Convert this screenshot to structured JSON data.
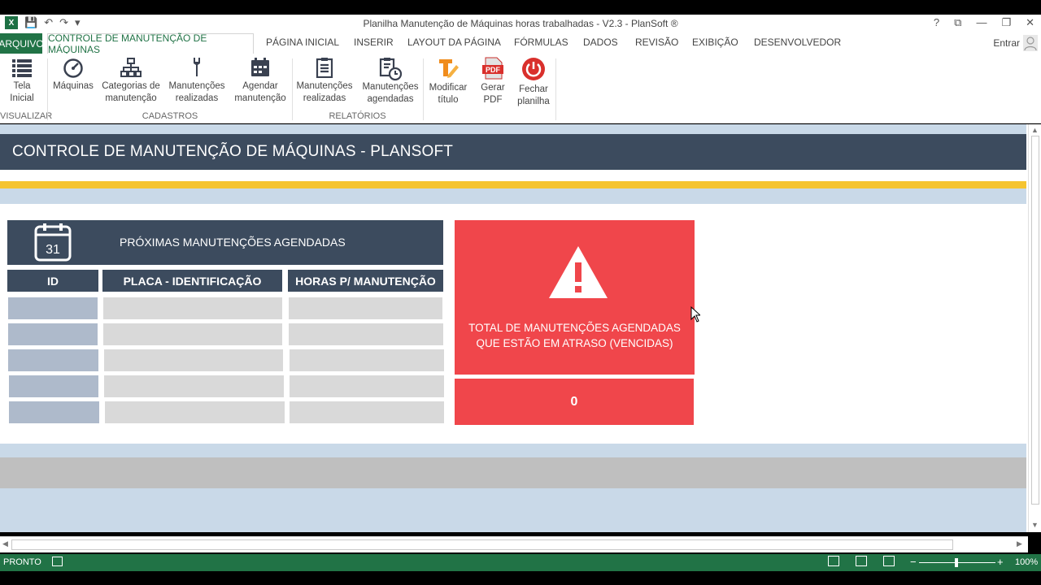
{
  "window": {
    "title": "Planilha Manutenção de Máquinas horas trabalhadas - V2.3 - PlanSoft ®",
    "controls": [
      "?",
      "⧉",
      "—",
      "❐",
      "✕"
    ]
  },
  "ribbon_tabs": {
    "file": "ARQUIVO",
    "active": "CONTROLE DE MANUTENÇÃO DE MÁQUINAS",
    "items": [
      "PÁGINA INICIAL",
      "INSERIR",
      "LAYOUT DA PÁGINA",
      "FÓRMULAS",
      "DADOS",
      "REVISÃO",
      "EXIBIÇÃO",
      "DESENVOLVEDOR"
    ],
    "signin": "Entrar"
  },
  "ribbon": {
    "buttons": [
      {
        "line1": "Tela",
        "line2": "Inicial",
        "icon": "list-icon"
      },
      {
        "line1": "Máquinas",
        "line2": "",
        "icon": "gauge-icon"
      },
      {
        "line1": "Categorias de",
        "line2": "manutenção",
        "icon": "hierarchy-icon"
      },
      {
        "line1": "Manutenções",
        "line2": "realizadas",
        "icon": "wrench-icon"
      },
      {
        "line1": "Agendar",
        "line2": "manutenção",
        "icon": "calendar-icon"
      },
      {
        "line1": "Manutenções",
        "line2": "realizadas",
        "icon": "clipboard-icon"
      },
      {
        "line1": "Manutenções",
        "line2": "agendadas",
        "icon": "clipboard-clock-icon"
      },
      {
        "line1": "Modificar",
        "line2": "título",
        "icon": "edit-title-icon"
      },
      {
        "line1": "Gerar",
        "line2": "PDF",
        "icon": "pdf-icon"
      },
      {
        "line1": "Fechar",
        "line2": "planilha",
        "icon": "power-icon"
      }
    ],
    "groups": [
      "VISUALIZAR",
      "CADASTROS",
      "RELATÓRIOS"
    ]
  },
  "sheet": {
    "header": "CONTROLE DE MANUTENÇÃO DE MÁQUINAS - PLANSOFT",
    "upcoming": {
      "title": "PRÓXIMAS MANUTENÇÕES AGENDADAS",
      "calendar_day": "31",
      "columns": [
        "ID",
        "PLACA - IDENTIFICAÇÃO",
        "HORAS P/ MANUTENÇÃO"
      ],
      "rows": [
        [
          "",
          "",
          ""
        ],
        [
          "",
          "",
          ""
        ],
        [
          "",
          "",
          ""
        ],
        [
          "",
          "",
          ""
        ],
        [
          "",
          "",
          ""
        ]
      ]
    },
    "overdue": {
      "line1": "TOTAL DE MANUTENÇÕES AGENDADAS",
      "line2": "QUE ESTÃO EM ATRASO (VENCIDAS)",
      "count": "0"
    }
  },
  "status": {
    "ready": "PRONTO",
    "zoom": "100%"
  },
  "colors": {
    "excel_green": "#217346",
    "header_navy": "#3c4b5e",
    "alert_red": "#f0464b",
    "yellow": "#f5c431",
    "light_blue": "#c9d9e8"
  }
}
